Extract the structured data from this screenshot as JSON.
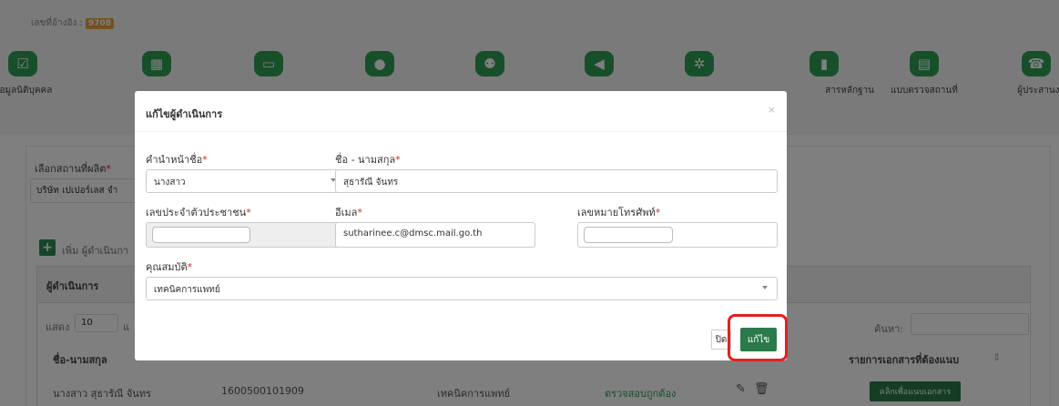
{
  "ref": {
    "label": "เลขที่อ้างอิง :",
    "value": "9708"
  },
  "steps": [
    {
      "icon": "check-square-icon",
      "label": "ข้อมูลนิติบุคคล",
      "glyph": "☑"
    },
    {
      "icon": "building-icon",
      "label": "",
      "glyph": "▦"
    },
    {
      "icon": "archive-icon",
      "label": "",
      "glyph": "▭"
    },
    {
      "icon": "user-icon",
      "label": "",
      "glyph": "●"
    },
    {
      "icon": "users-icon",
      "label": "",
      "glyph": "⚉"
    },
    {
      "icon": "megaphone-icon",
      "label": "",
      "glyph": "◀"
    },
    {
      "icon": "gears-icon",
      "label": "",
      "glyph": "✲"
    },
    {
      "icon": "file-icon",
      "label": "สารหลักฐาน",
      "glyph": "▮"
    },
    {
      "icon": "clipboard-icon",
      "label": "แบบตรวจสถานที่",
      "glyph": "▤"
    },
    {
      "icon": "phone-icon",
      "label": "ผู้ประสานงาน",
      "glyph": "☎"
    }
  ],
  "page": {
    "select_place_label": "เลือกสถานที่ผลิต",
    "select_place_value": "บริษัท เปเปอร์เลส จำ",
    "add_label": "เพิ่ม ผู้ดำเนินกา",
    "table_title": "ผู้ดำเนินการ",
    "show_label": "แสดง",
    "show_value": "10",
    "show_suffix": "แ",
    "search_label": "ค้นหา:",
    "col_name": "ชื่อ-นามสกุล",
    "col_docs": "รายการเอกสารที่ต้องแนบ",
    "row": {
      "name": "นางสาว สุธารัณี จันทร",
      "id": "1600500101909",
      "qualification": "เทคนิคการแพทย์",
      "status": "ตรวจสอบถูกต้อง",
      "attach": "คลิกเพื่อแนบเอกสาร"
    }
  },
  "modal": {
    "title": "แก้ไขผู้ดำเนินการ",
    "close_x": "×",
    "prefix_label": "คำนำหน้าชื่อ",
    "prefix_value": "นางสาว",
    "name_label": "ชื่อ - นามสกุล",
    "name_value": "สุธารัณี จันทร",
    "idcard_label": "เลขประจำตัวประชาชน",
    "email_label": "อีเมล",
    "email_value": "sutharinee.c@dmsc.mail.go.th",
    "phone_label": "เลขหมายโทรศัพท์",
    "qual_label": "คุณสมบัติ",
    "qual_value": "เทคนิคการแพทย์",
    "close_btn": "ปิด",
    "save_btn": "แก้ไข",
    "required_mark": "*"
  },
  "colors": {
    "primary_green": "#2e8b57",
    "highlight_red": "#e32020"
  }
}
